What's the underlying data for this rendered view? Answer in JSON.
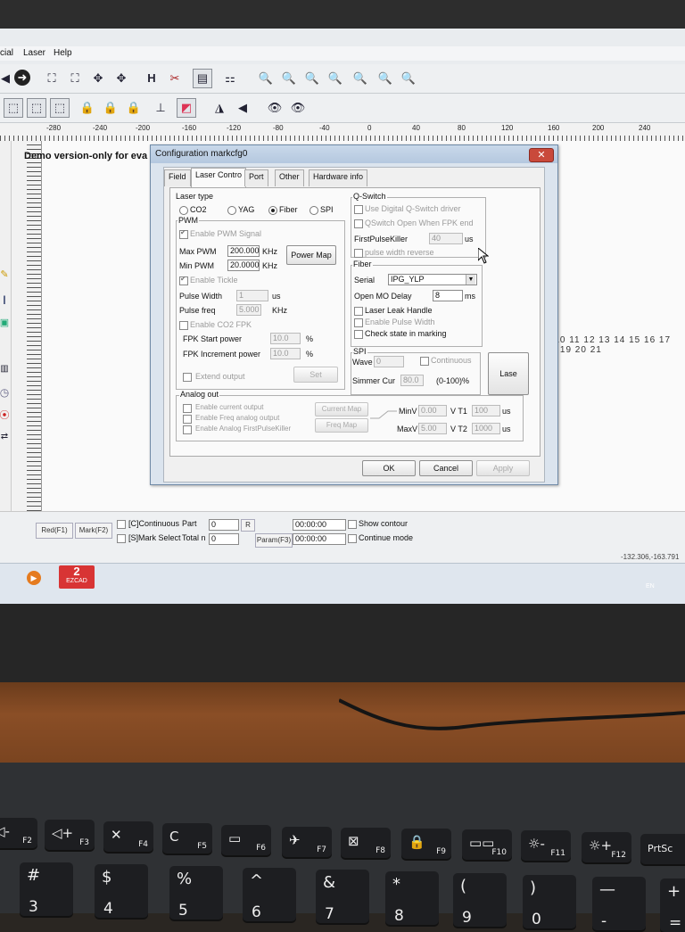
{
  "app": {
    "menu": [
      "cial",
      "Laser",
      "Help"
    ],
    "demo_text": "Demo version-only for eva",
    "ruler_h": [
      "-280",
      "-240",
      "-200",
      "-160",
      "-120",
      "-80",
      "-40",
      "0",
      "40",
      "80",
      "120",
      "160",
      "200",
      "240"
    ],
    "ruler_v": [
      "160",
      "120",
      "80",
      "40",
      "0",
      "-40",
      "-80",
      "-120",
      "-160"
    ],
    "canvas_ruler_labels": "8 10 11 12 13 14 15 16 17 18 19 20 21"
  },
  "status": {
    "red_button": "Red(F1)",
    "mark_button": "Mark(F2)",
    "continuous_label": "[C]Continuous",
    "mark_select_label": "[S]Mark Select",
    "part_label": "Part",
    "part_value": "0",
    "total_label": "Total n",
    "total_value": "0",
    "r_button": "R",
    "time1": "00:00:00",
    "time2": "00:00:00",
    "param_button": "Param(F3)",
    "show_contour": "Show contour",
    "continue_mode": "Continue mode",
    "coords": "-132.306,-163.791",
    "lang": "EN",
    "taskbar_app": "EZCAD"
  },
  "dialog": {
    "title": "Configuration markcfg0",
    "close": "✕",
    "tabs": [
      "Field",
      "Laser Contro",
      "Port",
      "Other",
      "Hardware info"
    ],
    "active_tab": 1,
    "laser_type": {
      "legend": "Laser type",
      "options": [
        "CO2",
        "YAG",
        "Fiber",
        "SPI"
      ],
      "selected": "Fiber"
    },
    "pwm": {
      "legend": "PWM",
      "enable_pwm": "Enable PWM Signal",
      "max_pwm_label": "Max PWM",
      "max_pwm_value": "200.000",
      "min_pwm_label": "Min PWM",
      "min_pwm_value": "20.0000",
      "unit_khz": "KHz",
      "power_map_button": "Power Map",
      "enable_tickle": "Enable Tickle",
      "pulse_width_label": "Pulse Width",
      "pulse_width_value": "1",
      "unit_us": "us",
      "pulse_freq_label": "Pulse freq",
      "pulse_freq_value": "5.000",
      "enable_co2_fpk": "Enable CO2 FPK",
      "fpk_start_label": "FPK Start power",
      "fpk_start_value": "10.0",
      "fpk_inc_label": "FPK Increment power",
      "fpk_inc_value": "10.0",
      "unit_pct": "%",
      "extend_output": "Extend output",
      "set_button": "Set"
    },
    "qswitch": {
      "legend": "Q-Switch",
      "use_digital": "Use Digital Q-Switch driver",
      "qswitch_open": "QSwitch Open When FPK end",
      "first_pulse_label": "FirstPulseKiller",
      "first_pulse_value": "40",
      "unit_us": "us",
      "pulse_width_reverse": "pulse width reverse"
    },
    "fiber": {
      "legend": "Fiber",
      "serial_label": "Serial",
      "serial_value": "IPG_YLP",
      "open_mo_label": "Open MO Delay",
      "open_mo_value": "8",
      "unit_ms": "ms",
      "laser_leak": "Laser Leak Handle",
      "enable_pulse_width": "Enable Pulse Width",
      "check_state": "Check state in marking"
    },
    "spi": {
      "legend": "SPI",
      "wave_label": "Wave",
      "wave_value": "0",
      "continuous": "Continuous",
      "simmer_label": "Simmer Cur",
      "simmer_value": "80.0",
      "simmer_range": "(0-100)%",
      "lase_button": "Lase"
    },
    "analog": {
      "legend": "Analog out",
      "enable_current": "Enable current output",
      "enable_freq": "Enable Freq analog output",
      "enable_analog_fpk": "Enable Analog FirstPulseKiller",
      "current_map": "Current Map",
      "freq_map": "Freq Map",
      "minv_label": "MinV",
      "minv_value": "0.00",
      "maxv_label": "MaxV",
      "maxv_value": "5.00",
      "vt1_label": "V T1",
      "vt1_value": "100",
      "vt2_label": "V T2",
      "vt2_value": "1000",
      "unit_us": "us"
    },
    "buttons": {
      "ok": "OK",
      "cancel": "Cancel",
      "apply": "Apply"
    }
  },
  "keyboard": {
    "fkeys": [
      {
        "glyph": "◁-",
        "fn": "F2"
      },
      {
        "glyph": "◁+",
        "fn": "F3"
      },
      {
        "glyph": "✕",
        "fn": "F4"
      },
      {
        "glyph": "C",
        "fn": "F5"
      },
      {
        "glyph": "▭",
        "fn": "F6"
      },
      {
        "glyph": "✈",
        "fn": "F7"
      },
      {
        "glyph": "⊠",
        "fn": "F8"
      },
      {
        "glyph": "🔒",
        "fn": "F9"
      },
      {
        "glyph": "▭▭",
        "fn": "F10"
      },
      {
        "glyph": "☼-",
        "fn": "F11"
      },
      {
        "glyph": "☼+",
        "fn": "F12"
      },
      {
        "glyph": "PrtSc",
        "fn": ""
      }
    ],
    "numkeys": [
      {
        "top": "#",
        "bottom": "3"
      },
      {
        "top": "$",
        "bottom": "4"
      },
      {
        "top": "%",
        "bottom": "5"
      },
      {
        "top": "^",
        "bottom": "6"
      },
      {
        "top": "&",
        "bottom": "7"
      },
      {
        "top": "*",
        "bottom": "8"
      },
      {
        "top": "(",
        "bottom": "9"
      },
      {
        "top": ")",
        "bottom": "0"
      },
      {
        "top": "—",
        "bottom": "-"
      },
      {
        "top": "+",
        "bottom": "="
      }
    ]
  }
}
